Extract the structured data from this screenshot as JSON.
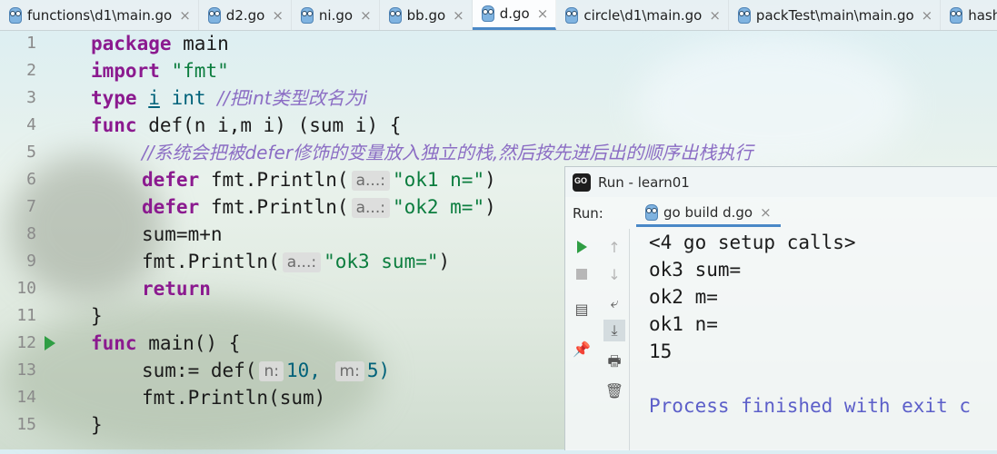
{
  "tabs": [
    {
      "label": "functions\\d1\\main.go",
      "active": false
    },
    {
      "label": "d2.go",
      "active": false
    },
    {
      "label": "ni.go",
      "active": false
    },
    {
      "label": "bb.go",
      "active": false
    },
    {
      "label": "d.go",
      "active": true
    },
    {
      "label": "circle\\d1\\main.go",
      "active": false
    },
    {
      "label": "packTest\\main\\main.go",
      "active": false
    },
    {
      "label": "hash",
      "active": false
    }
  ],
  "editor": {
    "line_numbers": [
      "1",
      "2",
      "3",
      "4",
      "5",
      "6",
      "7",
      "8",
      "9",
      "10",
      "11",
      "12",
      "13",
      "14",
      "15"
    ],
    "l1": {
      "kw": "package",
      "rest": " main"
    },
    "l2": {
      "kw": "import",
      "str": "\"fmt\""
    },
    "l3": {
      "kw": "type",
      "ident": "i",
      "type": "int",
      "comment": "//把int类型改名为i"
    },
    "l4": {
      "kw": "func",
      "text": " def(n i,m i) (sum i) {"
    },
    "l5": {
      "comment": "//系统会把被defer修饰的变量放入独立的栈,然后按先进后出的顺序出栈执行"
    },
    "l6": {
      "kw": "defer",
      "call": " fmt.Println(",
      "hint": "a...:",
      "str": "\"ok1 n=\"",
      "end": ")"
    },
    "l7": {
      "kw": "defer",
      "call": " fmt.Println(",
      "hint": "a...:",
      "str": "\"ok2 m=\"",
      "end": ")"
    },
    "l8": {
      "text": "sum=m+n"
    },
    "l9": {
      "call": "fmt.Println(",
      "hint": "a...:",
      "str": "\"ok3 sum=\"",
      "end": ")"
    },
    "l10": {
      "kw": "return"
    },
    "l11": {
      "text": "}"
    },
    "l12": {
      "kw": "func",
      "text": " main() {"
    },
    "l13": {
      "text": "sum:= def(",
      "hint1": "n:",
      "arg1": "10,",
      "hint2": "m:",
      "arg2": "5)"
    },
    "l14": {
      "text": "fmt.Println(sum)"
    },
    "l15": {
      "text": "}"
    }
  },
  "run_panel": {
    "title": "Run - learn01",
    "label": "Run:",
    "config_tab": "go build d.go",
    "output": [
      "<4 go setup calls>",
      "ok3 sum=",
      "ok2 m=",
      "ok1 n=",
      "15",
      "",
      "Process finished with exit c"
    ]
  }
}
